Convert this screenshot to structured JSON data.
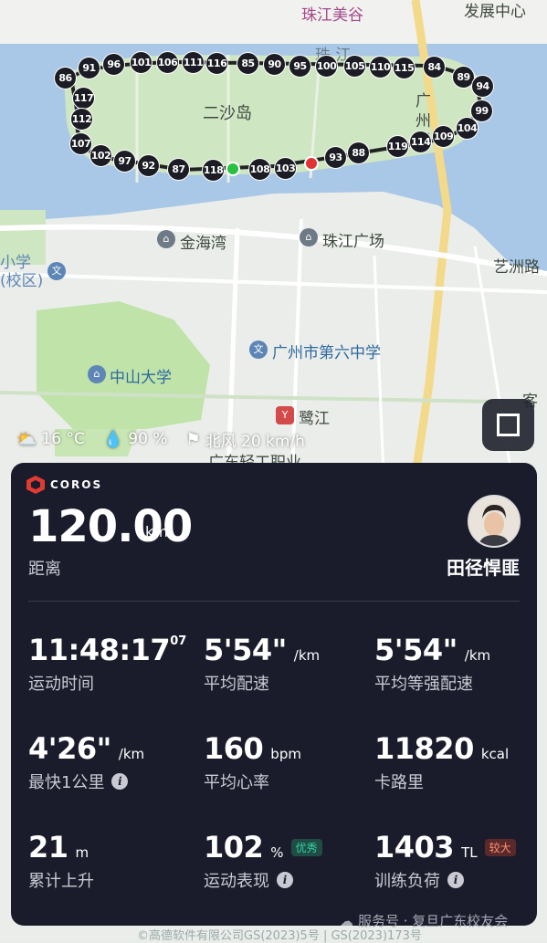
{
  "map": {
    "labels": {
      "pearl_river": "珠 江",
      "ershadao": "二沙岛",
      "guangzhou_bridge": "广州桥",
      "jinhaiwan": "金海湾",
      "zhujiang_square": "珠江广场",
      "yizhou_road": "艺洲路",
      "primary_school": "小学(校区)",
      "sysu": "中山大学",
      "no6_middle_school": "广州市第六中学",
      "lujiang": "鹭江",
      "gd_light_industry": "广东轻工职业",
      "top_poi": "珠江美谷",
      "top_right_poi": "发展中心",
      "right_edge": "客"
    },
    "km_markers": [
      "86",
      "91",
      "96",
      "101",
      "106",
      "111",
      "116",
      "85",
      "90",
      "95",
      "100",
      "105",
      "110",
      "115",
      "84",
      "89",
      "94",
      "99",
      "104",
      "109",
      "114",
      "119",
      "117",
      "112",
      "107",
      "102",
      "97",
      "92",
      "87",
      "118",
      "108",
      "103",
      "93",
      "88"
    ],
    "footer": "©高德软件有限公司GS(2023)5号 | GS(2023)173号"
  },
  "weather": {
    "temperature": "16 °C",
    "humidity": "90 %",
    "wind": "北风 20 km/h",
    "icons": [
      "partly-cloudy-icon",
      "droplet-icon",
      "wind-flag-icon"
    ]
  },
  "card": {
    "brand": "COROS",
    "distance": {
      "value": "120.00",
      "unit": "km",
      "label": "距离"
    },
    "user": {
      "name": "田径悍匪"
    },
    "metrics": [
      {
        "value": "11:48:17",
        "sup": "07",
        "unit": "",
        "label": "运动时间"
      },
      {
        "value": "5'54\"",
        "unit": "/km",
        "label": "平均配速"
      },
      {
        "value": "5'54\"",
        "unit": "/km",
        "label": "平均等强配速"
      },
      {
        "value": "4'26\"",
        "unit": "/km",
        "label": "最快1公里",
        "info": "i"
      },
      {
        "value": "160",
        "unit": "bpm",
        "label": "平均心率"
      },
      {
        "value": "11820",
        "unit": "kcal",
        "label": "卡路里"
      },
      {
        "value": "21",
        "unit": "m",
        "label": "累计上升"
      },
      {
        "value": "102",
        "unit": "%",
        "label": "运动表现",
        "badge": "优秀",
        "info": "i"
      },
      {
        "value": "1403",
        "unit": "TL",
        "label": "训练负荷",
        "badge": "较大",
        "info": "i"
      }
    ]
  },
  "watermark": "服务号 · 复旦广东校友会",
  "colors": {
    "accent_red": "#e03b32",
    "card_bg": "#1a1c2b",
    "river": "#a9c7e6",
    "green_area": "#bfe3a9",
    "road_yellow": "#f3d98a"
  }
}
